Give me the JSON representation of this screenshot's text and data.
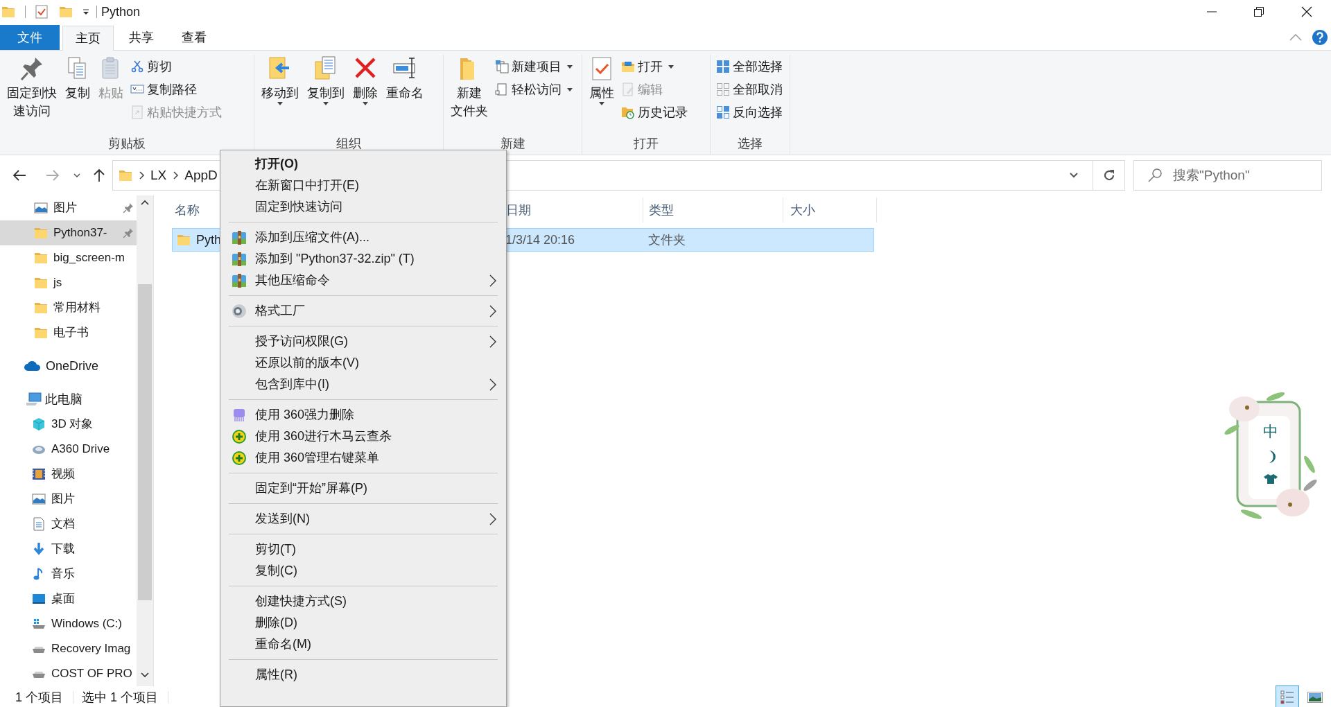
{
  "window": {
    "title": "Python"
  },
  "ribbon_tabs": [
    {
      "label": "文件",
      "kind": "file",
      "selected": false
    },
    {
      "label": "主页",
      "kind": "tab",
      "selected": true
    },
    {
      "label": "共享",
      "kind": "tab",
      "selected": false
    },
    {
      "label": "查看",
      "kind": "tab",
      "selected": false
    }
  ],
  "ribbon_groups": [
    {
      "label": "剪贴板",
      "items": [
        {
          "lines": [
            "固定到快",
            "速访问"
          ],
          "kind": "large",
          "disabled": false,
          "dropdown": false
        },
        {
          "lines": [
            "复制"
          ],
          "kind": "large",
          "disabled": false,
          "dropdown": false
        },
        {
          "lines": [
            "粘贴"
          ],
          "kind": "large",
          "disabled": true,
          "dropdown": false
        },
        {
          "label": "剪切",
          "kind": "small",
          "disabled": false,
          "dropdown": false
        },
        {
          "label": "复制路径",
          "kind": "small",
          "disabled": false,
          "dropdown": false
        },
        {
          "label": "粘贴快捷方式",
          "kind": "small",
          "disabled": true,
          "dropdown": false
        }
      ]
    },
    {
      "label": "组织",
      "items": [
        {
          "lines": [
            "移动到"
          ],
          "kind": "large",
          "disabled": false,
          "dropdown": true
        },
        {
          "lines": [
            "复制到"
          ],
          "kind": "large",
          "disabled": false,
          "dropdown": true
        },
        {
          "lines": [
            "删除"
          ],
          "kind": "large",
          "disabled": false,
          "dropdown": true
        },
        {
          "lines": [
            "重命名"
          ],
          "kind": "large",
          "disabled": false,
          "dropdown": false
        }
      ]
    },
    {
      "label": "新建",
      "items": [
        {
          "lines": [
            "新建",
            "文件夹"
          ],
          "kind": "large",
          "disabled": false,
          "dropdown": false
        },
        {
          "label": "新建项目",
          "kind": "small",
          "disabled": false,
          "dropdown": true
        },
        {
          "label": "轻松访问",
          "kind": "small",
          "disabled": false,
          "dropdown": true
        }
      ]
    },
    {
      "label": "打开",
      "items": [
        {
          "lines": [
            "属性"
          ],
          "kind": "large",
          "disabled": false,
          "dropdown": true
        },
        {
          "label": "打开",
          "kind": "small",
          "disabled": false,
          "dropdown": true
        },
        {
          "label": "编辑",
          "kind": "small",
          "disabled": true,
          "dropdown": false
        },
        {
          "label": "历史记录",
          "kind": "small",
          "disabled": false,
          "dropdown": false
        }
      ]
    },
    {
      "label": "选择",
      "items": [
        {
          "label": "全部选择",
          "kind": "small",
          "disabled": false,
          "dropdown": false
        },
        {
          "label": "全部取消",
          "kind": "small",
          "disabled": false,
          "dropdown": false
        },
        {
          "label": "反向选择",
          "kind": "small",
          "disabled": false,
          "dropdown": false
        }
      ]
    }
  ],
  "address_bar": {
    "crumbs": [
      "LX",
      "AppD"
    ]
  },
  "search": {
    "placeholder": "搜索\"Python\""
  },
  "nav_pane": {
    "quick_access": [
      {
        "label": "图片",
        "kind": "pictures",
        "pinned": true,
        "selected": false
      },
      {
        "label": "Python37-",
        "kind": "folder",
        "pinned": true,
        "selected": true
      },
      {
        "label": "big_screen-m",
        "kind": "folder",
        "pinned": false,
        "selected": false
      },
      {
        "label": "js",
        "kind": "folder",
        "pinned": false,
        "selected": false
      },
      {
        "label": "常用材料",
        "kind": "folder",
        "pinned": false,
        "selected": false
      },
      {
        "label": "电子书",
        "kind": "folder",
        "pinned": false,
        "selected": false
      }
    ],
    "onedrive": {
      "label": "OneDrive"
    },
    "this_pc": {
      "label": "此电脑",
      "children": [
        {
          "label": "3D 对象",
          "kind": "objects"
        },
        {
          "label": "A360 Drive",
          "kind": "cloud"
        },
        {
          "label": "视频",
          "kind": "videos"
        },
        {
          "label": "图片",
          "kind": "pictures"
        },
        {
          "label": "文档",
          "kind": "documents"
        },
        {
          "label": "下载",
          "kind": "downloads"
        },
        {
          "label": "音乐",
          "kind": "music"
        },
        {
          "label": "桌面",
          "kind": "desktop"
        },
        {
          "label": "Windows (C:)",
          "kind": "system"
        },
        {
          "label": "Recovery Imag",
          "kind": "drive"
        },
        {
          "label": "COST OF PRO",
          "kind": "drive"
        }
      ]
    }
  },
  "file_list": {
    "columns": [
      "名称",
      "日期",
      "类型",
      "大小"
    ],
    "rows": [
      {
        "name": "Pyth",
        "modified": "1/3/14 20:16",
        "type": "文件夹",
        "selected": true
      }
    ]
  },
  "context_menu": {
    "sections": [
      [
        {
          "label": "打开(O)",
          "default": true,
          "submenu": false,
          "kind": "plain"
        },
        {
          "label": "在新窗口中打开(E)",
          "default": false,
          "submenu": false,
          "kind": "plain"
        },
        {
          "label": "固定到快速访问",
          "default": false,
          "submenu": false,
          "kind": "plain"
        }
      ],
      [
        {
          "label": "添加到压缩文件(A)...",
          "default": false,
          "submenu": false,
          "kind": "archive"
        },
        {
          "label": "添加到 \"Python37-32.zip\" (T)",
          "default": false,
          "submenu": false,
          "kind": "archive"
        },
        {
          "label": "其他压缩命令",
          "default": false,
          "submenu": true,
          "kind": "archive"
        }
      ],
      [
        {
          "label": "格式工厂",
          "default": false,
          "submenu": true,
          "kind": "converter"
        }
      ],
      [
        {
          "label": "授予访问权限(G)",
          "default": false,
          "submenu": true,
          "kind": "plain"
        },
        {
          "label": "还原以前的版本(V)",
          "default": false,
          "submenu": false,
          "kind": "plain"
        },
        {
          "label": "包含到库中(I)",
          "default": false,
          "submenu": true,
          "kind": "plain"
        }
      ],
      [
        {
          "label": "使用 360强力删除",
          "default": false,
          "submenu": false,
          "kind": "shredder"
        },
        {
          "label": "使用 360进行木马云查杀",
          "default": false,
          "submenu": false,
          "kind": "guard"
        },
        {
          "label": "使用 360管理右键菜单",
          "default": false,
          "submenu": false,
          "kind": "guard"
        }
      ],
      [
        {
          "label": "固定到“开始”屏幕(P)",
          "default": false,
          "submenu": false,
          "kind": "plain"
        }
      ],
      [
        {
          "label": "发送到(N)",
          "default": false,
          "submenu": true,
          "kind": "plain"
        }
      ],
      [
        {
          "label": "剪切(T)",
          "default": false,
          "submenu": false,
          "kind": "plain"
        },
        {
          "label": "复制(C)",
          "default": false,
          "submenu": false,
          "kind": "plain"
        }
      ],
      [
        {
          "label": "创建快捷方式(S)",
          "default": false,
          "submenu": false,
          "kind": "plain"
        },
        {
          "label": "删除(D)",
          "default": false,
          "submenu": false,
          "kind": "plain"
        },
        {
          "label": "重命名(M)",
          "default": false,
          "submenu": false,
          "kind": "plain"
        }
      ],
      [
        {
          "label": "属性(R)",
          "default": false,
          "submenu": false,
          "kind": "plain"
        }
      ]
    ]
  },
  "status_bar": [
    "1 个项目",
    "选中 1 个项目"
  ],
  "view_buttons": [
    {
      "kind": "details",
      "selected": true
    },
    {
      "kind": "thumbnails",
      "selected": false
    }
  ],
  "ime_widget": {
    "mode": "中"
  }
}
